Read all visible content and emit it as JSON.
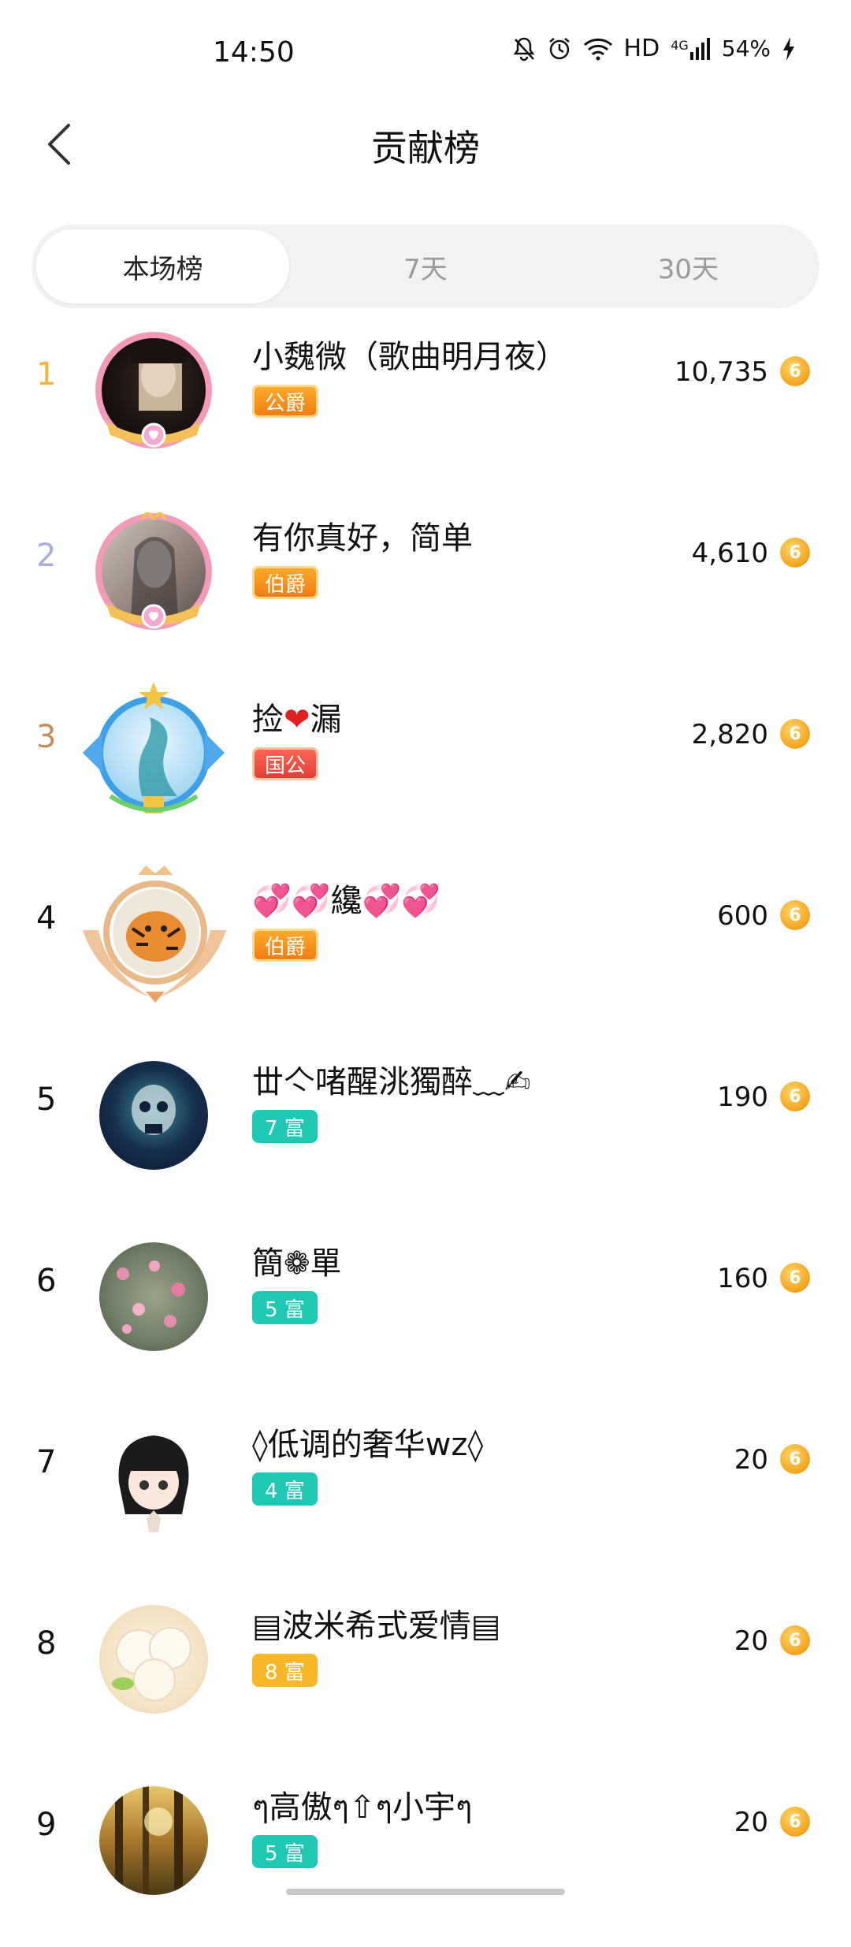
{
  "status": {
    "time": "14:50",
    "network": "HD",
    "signal": "4G",
    "battery": "54%"
  },
  "header": {
    "title": "贡献榜"
  },
  "tabs": [
    {
      "label": "本场榜",
      "active": true
    },
    {
      "label": "7天",
      "active": false
    },
    {
      "label": "30天",
      "active": false
    }
  ],
  "rows": [
    {
      "rank": "1",
      "name": "小魏微（歌曲明月夜）",
      "badge": "公爵",
      "score": "10,735"
    },
    {
      "rank": "2",
      "name": "有你真好，简单",
      "badge": "伯爵",
      "score": "4,610"
    },
    {
      "rank": "3",
      "name_pre": "捡",
      "name_heart": "❤",
      "name_post": "漏",
      "badge": "国公",
      "score": "2,820"
    },
    {
      "rank": "4",
      "name": "💞💞纔💞💞",
      "badge": "伯爵",
      "score": "600"
    },
    {
      "rank": "5",
      "name": "丗亽啫醒洮獨醉﹏✍",
      "badge": "7 富",
      "score": "190"
    },
    {
      "rank": "6",
      "name": "簡❁單",
      "badge": "5 富",
      "score": "160"
    },
    {
      "rank": "7",
      "name": "◊低调的奢华wz◊",
      "badge": "4 富",
      "score": "20"
    },
    {
      "rank": "8",
      "name": "▤波米希式爱情▤",
      "badge": "8 富",
      "score": "20"
    },
    {
      "rank": "9",
      "name": "ๆ高傲ๆ⇧ๆ小宇ๆ",
      "badge": "5 富",
      "score": "20"
    }
  ],
  "coin_glyph": "6",
  "colors": {
    "rank1": "#f0b43a",
    "rank2": "#a9aee0",
    "rank3": "#c88c5a",
    "badge_teal": "#1fc7b5",
    "badge_yellow": "#f7b729",
    "coin": "#f3a41d"
  }
}
